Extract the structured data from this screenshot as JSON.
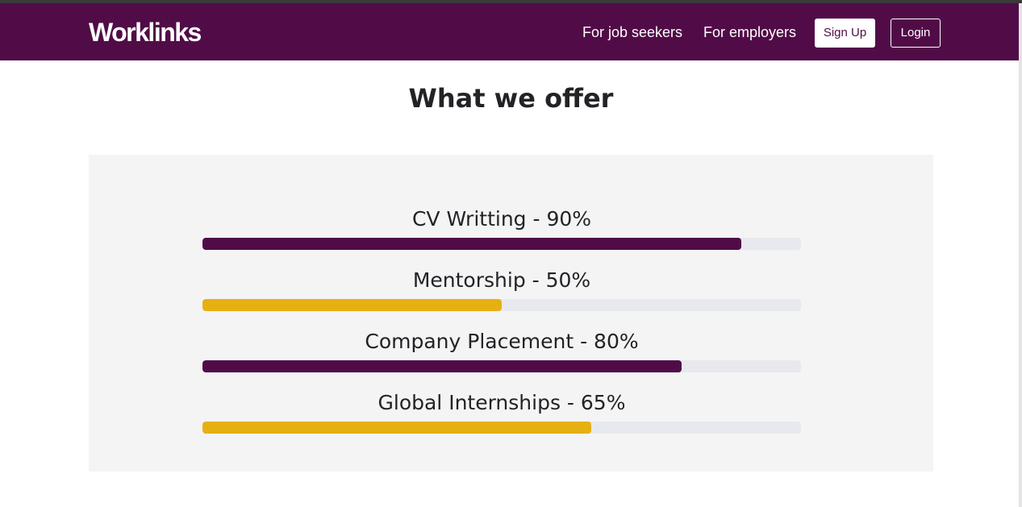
{
  "header": {
    "logo_text": "Worklinks",
    "nav": {
      "job_seekers": "For job seekers",
      "employers": "For employers",
      "signup": "Sign Up",
      "login": "Login"
    }
  },
  "section": {
    "title": "What we offer"
  },
  "skills": [
    {
      "label": "CV Writting - 90%",
      "progress": 0.9,
      "color": "#510c47"
    },
    {
      "label": "Mentorship - 50%",
      "progress": 0.5,
      "color": "#e6b012"
    },
    {
      "label": "Company Placement - 80%",
      "progress": 0.8,
      "color": "#510c47"
    },
    {
      "label": "Global Internships - 65%",
      "progress": 0.65,
      "color": "#e6b012"
    }
  ],
  "colors": {
    "brand": "#510c47",
    "accent": "#e6b012",
    "panel_bg": "#f4f4f5",
    "track_bg": "#e7e9ee"
  }
}
